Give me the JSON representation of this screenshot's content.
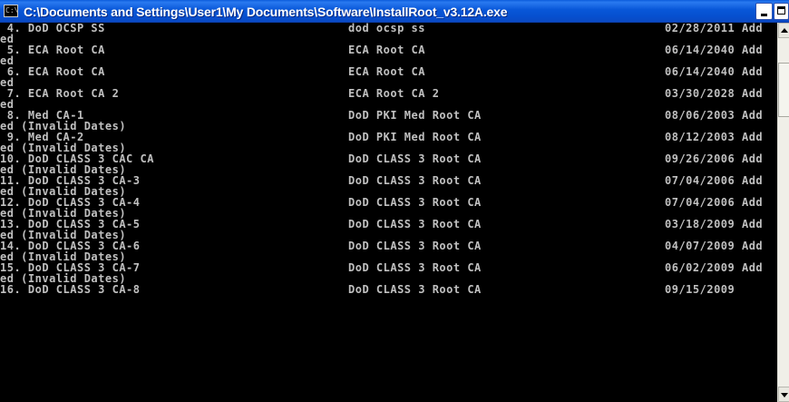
{
  "window": {
    "title": "C:\\Documents and Settings\\User1\\My Documents\\Software\\InstallRoot_v3.12A.exe",
    "icon_glyph": "C:\\",
    "icon": "console-icon"
  },
  "console": {
    "entries": [
      {
        "name": " 4. DoD OCSP SS",
        "issuer": "dod ocsp ss",
        "date": "02/28/2011",
        "status_head": " Add",
        "status_tail": "ed"
      },
      {
        "name": " 5. ECA Root CA",
        "issuer": "ECA Root CA",
        "date": "06/14/2040",
        "status_head": " Add",
        "status_tail": "ed"
      },
      {
        "name": " 6. ECA Root CA",
        "issuer": "ECA Root CA",
        "date": "06/14/2040",
        "status_head": " Add",
        "status_tail": "ed"
      },
      {
        "name": " 7. ECA Root CA 2",
        "issuer": "ECA Root CA 2",
        "date": "03/30/2028",
        "status_head": " Add",
        "status_tail": "ed"
      },
      {
        "name": " 8. Med CA-1",
        "issuer": "DoD PKI Med Root CA",
        "date": "08/06/2003",
        "status_head": " Add",
        "status_tail": "ed (Invalid Dates)"
      },
      {
        "name": " 9. Med CA-2",
        "issuer": "DoD PKI Med Root CA",
        "date": "08/12/2003",
        "status_head": " Add",
        "status_tail": "ed (Invalid Dates)"
      },
      {
        "name": "10. DoD CLASS 3 CAC CA",
        "issuer": "DoD CLASS 3 Root CA",
        "date": "09/26/2006",
        "status_head": " Add",
        "status_tail": "ed (Invalid Dates)"
      },
      {
        "name": "11. DoD CLASS 3 CA-3",
        "issuer": "DoD CLASS 3 Root CA",
        "date": "07/04/2006",
        "status_head": " Add",
        "status_tail": "ed (Invalid Dates)"
      },
      {
        "name": "12. DoD CLASS 3 CA-4",
        "issuer": "DoD CLASS 3 Root CA",
        "date": "07/04/2006",
        "status_head": " Add",
        "status_tail": "ed (Invalid Dates)"
      },
      {
        "name": "13. DoD CLASS 3 CA-5",
        "issuer": "DoD CLASS 3 Root CA",
        "date": "03/18/2009",
        "status_head": " Add",
        "status_tail": "ed (Invalid Dates)"
      },
      {
        "name": "14. DoD CLASS 3 CA-6",
        "issuer": "DoD CLASS 3 Root CA",
        "date": "04/07/2009",
        "status_head": " Add",
        "status_tail": "ed (Invalid Dates)"
      },
      {
        "name": "15. DoD CLASS 3 CA-7",
        "issuer": "DoD CLASS 3 Root CA",
        "date": "06/02/2009",
        "status_head": " Add",
        "status_tail": "ed (Invalid Dates)"
      },
      {
        "name": "16. DoD CLASS 3 CA-8",
        "issuer": "DoD CLASS 3 Root CA",
        "date": "09/15/2009",
        "status_head": "",
        "status_tail": ""
      }
    ]
  },
  "colors": {
    "titlebar": "#0857d8",
    "console_bg": "#000000",
    "console_text": "#c0c0c0"
  }
}
